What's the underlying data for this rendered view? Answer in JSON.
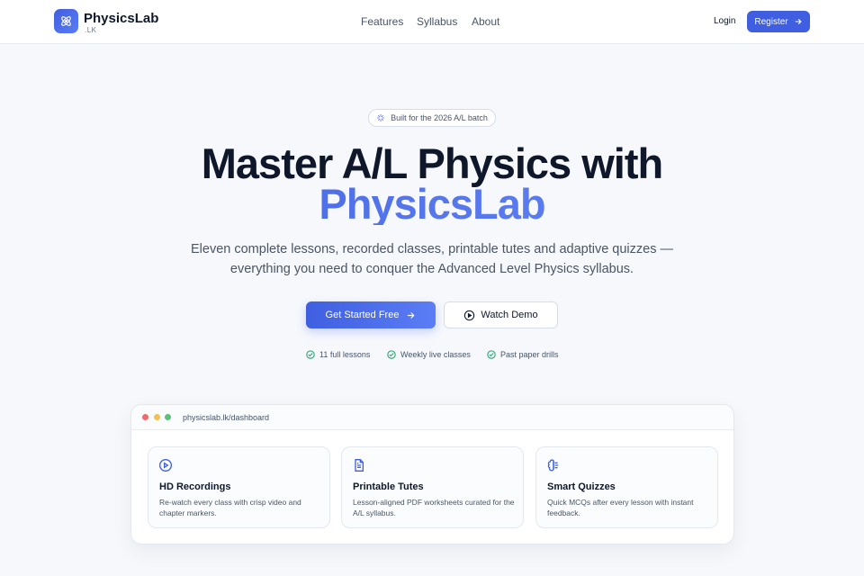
{
  "nav": {
    "brand": "PhysicsLab",
    "brand_suffix": ".LK",
    "links": [
      "Features",
      "Syllabus",
      "About"
    ],
    "login": "Login",
    "register": "Register"
  },
  "hero": {
    "badge": "Built for the 2026 A/L batch",
    "title_line1": "Master A/L Physics with",
    "title_line2": "PhysicsLab",
    "subtitle": "Eleven complete lessons, recorded classes, printable tutes and adaptive quizzes — everything you need to conquer the Advanced Level Physics syllabus.",
    "cta_primary": "Get Started Free",
    "cta_secondary": "Watch Demo",
    "perks": [
      "11 full lessons",
      "Weekly live classes",
      "Past paper drills"
    ]
  },
  "dashboard": {
    "url": "physicslab.lk/dashboard",
    "cards": [
      {
        "icon": "play-circle-icon",
        "title": "HD Recordings",
        "desc": "Re-watch every class with crisp video and chapter markers."
      },
      {
        "icon": "document-icon",
        "title": "Printable Tutes",
        "desc": "Lesson-aligned PDF worksheets curated for the A/L syllabus."
      },
      {
        "icon": "brain-icon",
        "title": "Smart Quizzes",
        "desc": "Quick MCQs after every lesson with instant feedback."
      }
    ]
  },
  "colors": {
    "accent": "#3f5fe0",
    "perk_check": "#22a06b",
    "dot_red": "#ef6b6b",
    "dot_yellow": "#f2c14e",
    "dot_green": "#5cbf7a"
  }
}
